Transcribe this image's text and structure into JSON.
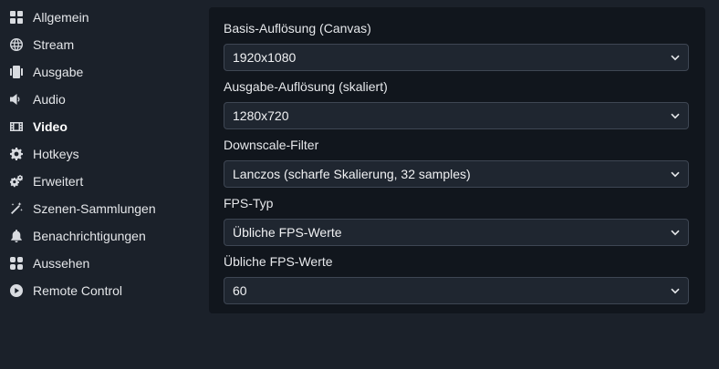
{
  "sidebar": {
    "items": [
      {
        "label": "Allgemein",
        "icon": "grid-icon"
      },
      {
        "label": "Stream",
        "icon": "globe-icon"
      },
      {
        "label": "Ausgabe",
        "icon": "output-icon"
      },
      {
        "label": "Audio",
        "icon": "speaker-icon"
      },
      {
        "label": "Video",
        "icon": "film-icon",
        "active": true
      },
      {
        "label": "Hotkeys",
        "icon": "gear-icon"
      },
      {
        "label": "Erweitert",
        "icon": "gears-icon"
      },
      {
        "label": "Szenen-Sammlungen",
        "icon": "wand-icon"
      },
      {
        "label": "Benachrichtigungen",
        "icon": "bell-icon"
      },
      {
        "label": "Aussehen",
        "icon": "palette-icon"
      },
      {
        "label": "Remote Control",
        "icon": "play-circle-icon"
      }
    ]
  },
  "video": {
    "fields": [
      {
        "label": "Basis-Auflösung (Canvas)",
        "value": "1920x1080"
      },
      {
        "label": "Ausgabe-Auflösung (skaliert)",
        "value": "1280x720"
      },
      {
        "label": "Downscale-Filter",
        "value": "Lanczos (scharfe Skalierung, 32 samples)"
      },
      {
        "label": "FPS-Typ",
        "value": "Übliche FPS-Werte"
      },
      {
        "label": "Übliche FPS-Werte",
        "value": "60"
      }
    ]
  },
  "colors": {
    "background": "#1b212a",
    "panel": "#11161d",
    "select_bg": "#1f2630",
    "select_border": "#3e4653",
    "text": "#e6e8eb"
  }
}
